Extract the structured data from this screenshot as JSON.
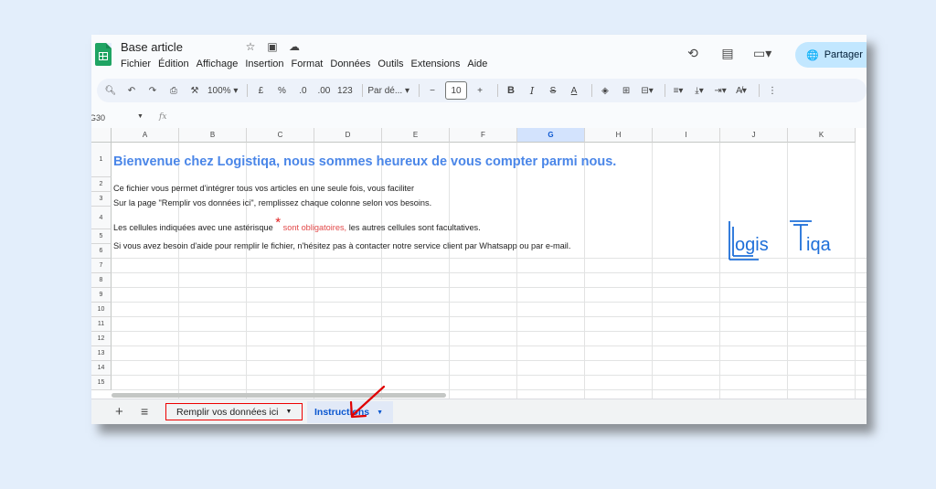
{
  "app": {
    "doc_title": "Base article",
    "menus": [
      "Fichier",
      "Édition",
      "Affichage",
      "Insertion",
      "Format",
      "Données",
      "Outils",
      "Extensions",
      "Aide"
    ],
    "share_label": "Partager"
  },
  "toolbar": {
    "zoom": "100%",
    "currency": "£",
    "percent": "%",
    "dec_decrease": ".0",
    "dec_increase": ".00",
    "number_format": "123",
    "font": "Par dé...",
    "font_size": "10"
  },
  "formula_bar": {
    "cell_ref": "G30",
    "fx": "fx"
  },
  "columns": [
    "A",
    "B",
    "C",
    "D",
    "E",
    "F",
    "G",
    "H",
    "I",
    "J",
    "K"
  ],
  "selected_column": "G",
  "rows": [
    "1",
    "2",
    "3",
    "4",
    "5",
    "6",
    "7",
    "8",
    "9",
    "10",
    "11",
    "12",
    "13",
    "14",
    "15"
  ],
  "cells": {
    "r1": "Bienvenue chez Logistiqa, nous sommes heureux de vous compter parmi nous.",
    "r2": "Ce fichier vous permet d'intégrer tous vos articles en une seule fois, vous faciliter",
    "r3": "Sur la page \"Remplir vos données ici\", remplissez chaque colonne selon vos besoins.",
    "r4_a": "Les cellules indiquées avec une astérisque",
    "r4_star": "*",
    "r4_red": "sont obligatoires,",
    "r4_b": "les autres cellules sont facultatives.",
    "r5": "Si vous avez besoin d'aide pour remplir le fichier, n'hésitez pas à contacter notre service client par Whatsapp ou par e-mail."
  },
  "brand": {
    "text_left": "ogis",
    "text_right": "iqa",
    "color": "#1e6fd9"
  },
  "tabs": {
    "tab1": "Remplir vos données ici",
    "tab2": "Instructions"
  },
  "colors": {
    "accent": "#4a86e8",
    "annotation_red": "#e00000",
    "share_bg": "#c2e7ff"
  }
}
